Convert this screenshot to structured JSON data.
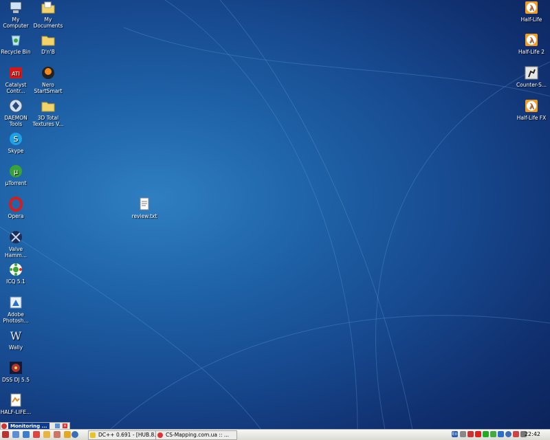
{
  "desktop": {
    "left_icons": [
      {
        "label": "My\nComputer",
        "icon": "computer-icon"
      },
      {
        "label": "My\nDocuments",
        "icon": "folder-documents-icon"
      },
      {
        "label": "Recycle Bin",
        "icon": "recycle-bin-icon"
      },
      {
        "label": "D'n'B",
        "icon": "folder-icon"
      },
      {
        "label": "Catalyst\nContr...",
        "icon": "ati-icon"
      },
      {
        "label": "Nero\nStartSmart",
        "icon": "nero-icon"
      },
      {
        "label": "DAEMON\nTools",
        "icon": "daemon-tools-icon"
      },
      {
        "label": "3D Total\nTextures V...",
        "icon": "folder-icon"
      },
      {
        "label": "Skype",
        "icon": "skype-icon"
      },
      {
        "label": "µTorrent",
        "icon": "utorrent-icon"
      },
      {
        "label": "Opera",
        "icon": "opera-icon"
      },
      {
        "label": "Valve\nHamm...",
        "icon": "hammer-icon"
      },
      {
        "label": "ICQ 5.1",
        "icon": "icq-icon"
      },
      {
        "label": "Adobe\nPhotosh...",
        "icon": "photoshop-icon"
      },
      {
        "label": "Wally",
        "icon": "wally-icon"
      },
      {
        "label": "DSS DJ 5.5",
        "icon": "dss-dj-icon"
      },
      {
        "label": "HALF-LIFE...",
        "icon": "document-icon"
      }
    ],
    "right_icons": [
      {
        "label": "Half-Life",
        "icon": "half-life-icon"
      },
      {
        "label": "Half-Life 2",
        "icon": "half-life-icon"
      },
      {
        "label": "Counter-S...",
        "icon": "counter-strike-icon"
      },
      {
        "label": "Half-Life FX",
        "icon": "half-life-icon"
      }
    ],
    "file_icon": {
      "label": "review.txt",
      "icon": "text-file-icon"
    }
  },
  "taskbar": {
    "panel_title": "Monitoring ...",
    "tasks": [
      {
        "label": "DC++ 0.691 - [HUB.8...",
        "icon": "dcpp-icon"
      },
      {
        "label": "CS-Mapping.com.ua :: ...",
        "icon": "opera-icon"
      }
    ],
    "clock": "22:42",
    "language": "En"
  }
}
